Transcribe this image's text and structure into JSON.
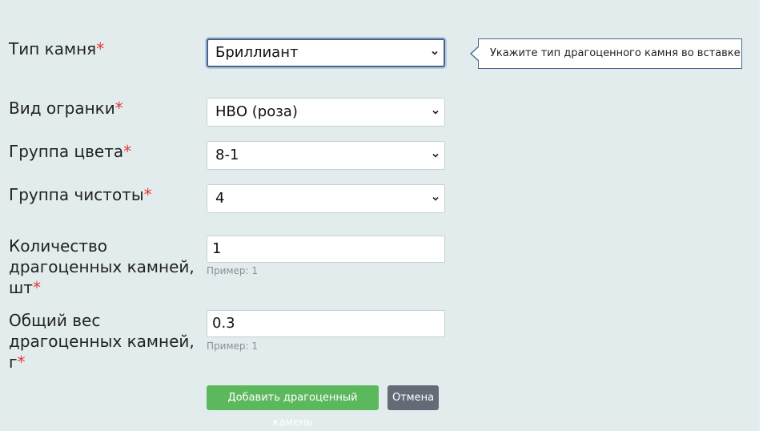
{
  "form": {
    "stone_type": {
      "label": "Тип камня",
      "required_mark": "*",
      "value": "Бриллиант"
    },
    "cut": {
      "label": "Вид огранки",
      "required_mark": "*",
      "value": "НВО (роза)"
    },
    "color_group": {
      "label": "Группа цвета",
      "required_mark": "*",
      "value": "8-1"
    },
    "clarity_group": {
      "label": "Группа чистоты",
      "required_mark": "*",
      "value": "4"
    },
    "quantity": {
      "label_lines": [
        "Количество",
        "драгоценных камней,",
        "шт"
      ],
      "required_mark": "*",
      "value": "1",
      "hint": "Пример: 1"
    },
    "weight": {
      "label_lines": [
        "Общий вес",
        "драгоценных камней,",
        "г"
      ],
      "required_mark": "*",
      "value": "0.3",
      "hint": "Пример: 1"
    }
  },
  "tooltip": {
    "text": "Укажите тип драгоценного камня во вставке"
  },
  "buttons": {
    "add": "Добавить драгоценный камень",
    "cancel": "Отмена"
  },
  "colors": {
    "background": "#e2eced",
    "required": "#e53935",
    "add_button": "#5cb85c",
    "cancel_button": "#646b76",
    "focus_border": "#44648c"
  },
  "icons": {
    "select_arrow": "chevron-down-icon"
  }
}
